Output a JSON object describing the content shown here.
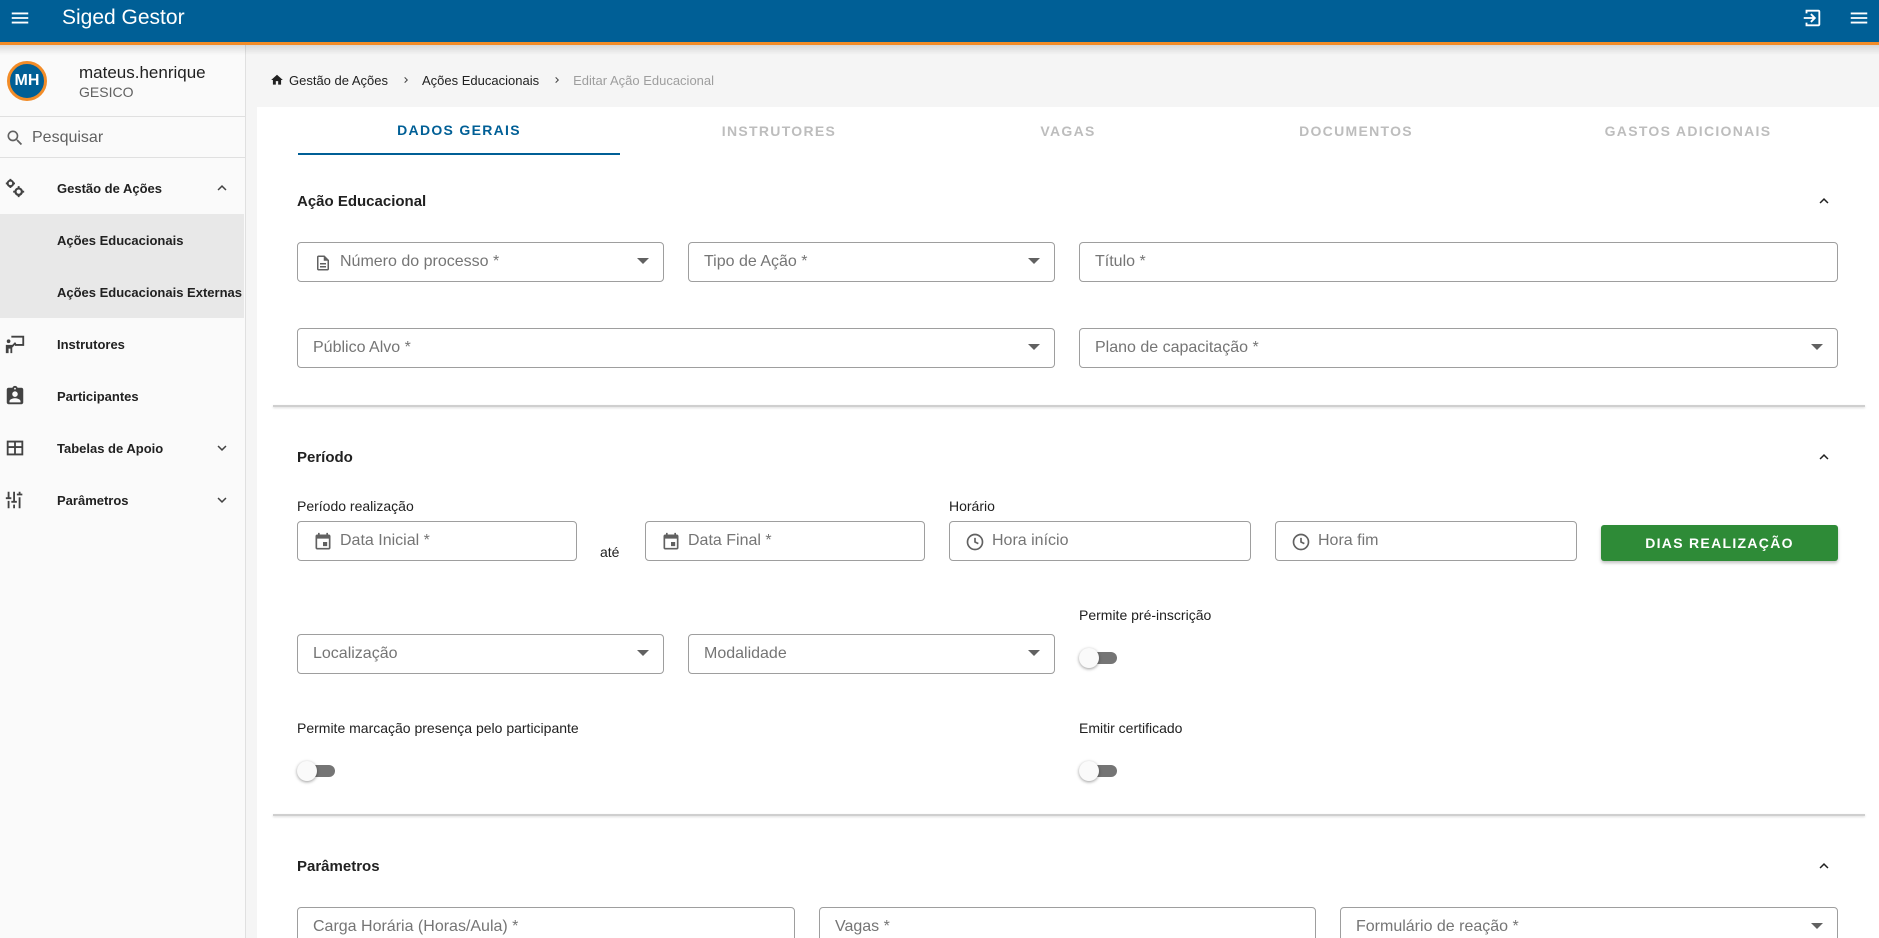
{
  "app": {
    "title": "Siged Gestor"
  },
  "user": {
    "initials": "MH",
    "name": "mateus.henrique",
    "org": "GESICO"
  },
  "search": {
    "placeholder": "Pesquisar"
  },
  "sidebar": {
    "items": [
      {
        "label": "Gestão de Ações",
        "icon": "gears-icon",
        "expanded": true,
        "children": [
          {
            "label": "Ações Educacionais"
          },
          {
            "label": "Ações Educacionais Externas"
          }
        ]
      },
      {
        "label": "Instrutores",
        "icon": "instructor-icon"
      },
      {
        "label": "Participantes",
        "icon": "clipboard-account-icon"
      },
      {
        "label": "Tabelas de Apoio",
        "icon": "table-icon",
        "expanded": false
      },
      {
        "label": "Parâmetros",
        "icon": "sliders-icon",
        "expanded": false
      }
    ]
  },
  "breadcrumb": [
    "Gestão de Ações",
    "Ações Educacionais",
    "Editar Ação Educacional"
  ],
  "tabs": [
    {
      "label": "DADOS GERAIS",
      "active": true
    },
    {
      "label": "INSTRUTORES"
    },
    {
      "label": "VAGAS"
    },
    {
      "label": "DOCUMENTOS"
    },
    {
      "label": "GASTOS ADICIONAIS"
    }
  ],
  "sections": {
    "acao": {
      "title": "Ação Educacional",
      "numero_processo": "Número do processo *",
      "tipo_acao": "Tipo de Ação *",
      "titulo": "Título *",
      "publico_alvo": "Público Alvo *",
      "plano_capacitacao": "Plano de capacitação *"
    },
    "periodo": {
      "title": "Período",
      "periodo_label": "Período realização",
      "data_inicial": "Data Inicial *",
      "ate": "até",
      "data_final": "Data Final *",
      "horario_label": "Horário",
      "hora_inicio": "Hora início",
      "hora_fim": "Hora fim",
      "dias_button": "DIAS REALIZAÇÃO",
      "localizacao": "Localização",
      "modalidade": "Modalidade",
      "pre_inscricao_label": "Permite pré-inscrição",
      "pre_inscricao": false,
      "marcacao_label": "Permite marcação presença pelo participante",
      "marcacao": false,
      "certificado_label": "Emitir certificado",
      "certificado": false
    },
    "parametros": {
      "title": "Parâmetros",
      "carga_horaria": "Carga Horária (Horas/Aula) *",
      "vagas": "Vagas *",
      "formulario_reacao": "Formulário de reação *"
    }
  },
  "colors": {
    "primary": "#005f96",
    "accent": "#f28c28",
    "success": "#2e8b37"
  }
}
